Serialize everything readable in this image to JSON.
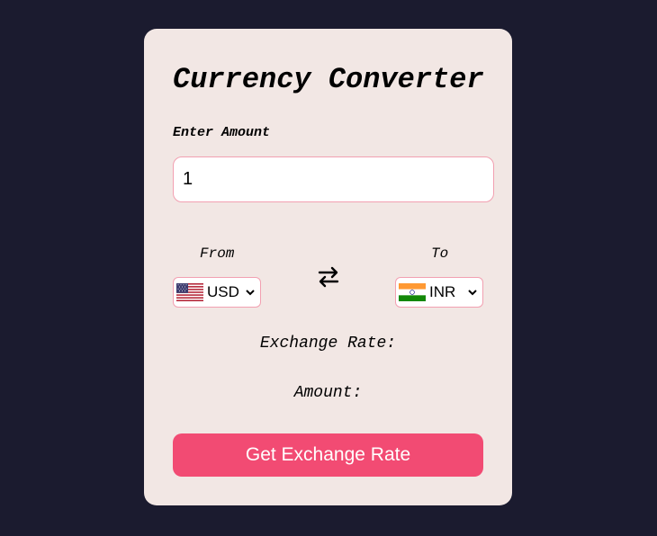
{
  "converter": {
    "title": "Currency Converter",
    "amount_label": "Enter Amount",
    "amount_value": "1",
    "from_label": "From",
    "to_label": "To",
    "from_currency": "USD",
    "to_currency": "INR",
    "from_flag": "us-flag-icon",
    "to_flag": "india-flag-icon",
    "swap_icon": "swap-arrows-icon",
    "exchange_rate_label": "Exchange Rate:",
    "result_label": "Amount:",
    "button_label": "Get Exchange Rate"
  },
  "colors": {
    "page_background": "#1b1b2f",
    "card_background": "#f2e7e4",
    "accent": "#f24b73",
    "input_border": "#f2a0b1"
  }
}
